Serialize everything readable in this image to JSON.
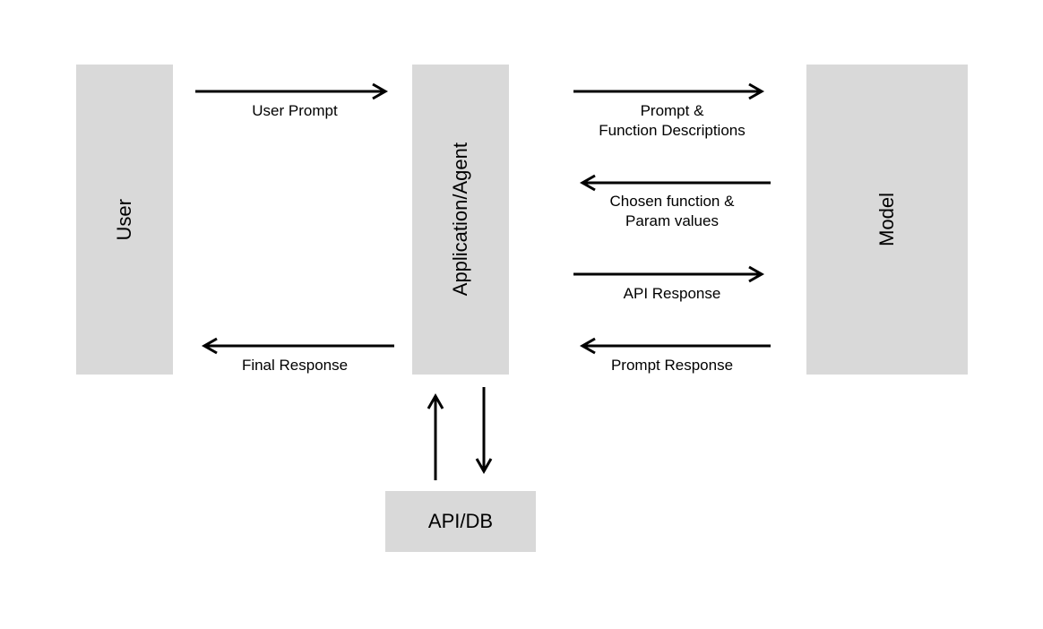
{
  "boxes": {
    "user": "User",
    "agent": "Application/Agent",
    "model": "Model",
    "apidb": "API/DB"
  },
  "arrows": {
    "user_prompt": "User Prompt",
    "final_response": "Final Response",
    "prompt_func_desc": "Prompt &\nFunction Descriptions",
    "chosen_func": "Chosen function &\nParam values",
    "api_response": "API Response",
    "prompt_response": "Prompt Response"
  }
}
